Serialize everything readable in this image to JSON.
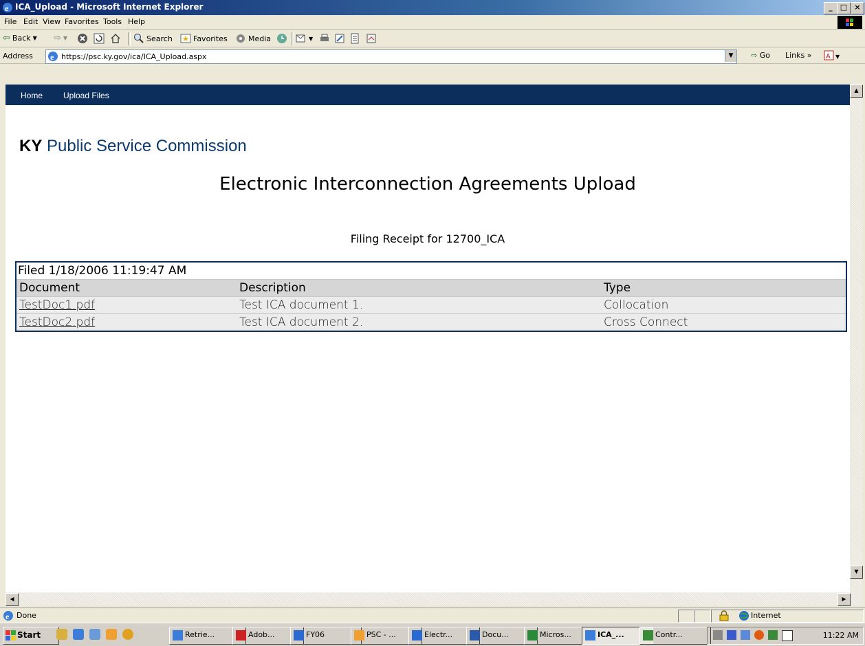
{
  "window": {
    "title": "ICA_Upload - Microsoft Internet Explorer",
    "controls": [
      "_",
      "□",
      "×"
    ]
  },
  "menubar": {
    "items": [
      "File",
      "Edit",
      "View",
      "Favorites",
      "Tools",
      "Help"
    ]
  },
  "toolbar": {
    "back": "Back",
    "search": "Search",
    "favorites": "Favorites",
    "media": "Media"
  },
  "addressbar": {
    "label": "Address",
    "url": "https://psc.ky.gov/ica/ICA_Upload.aspx",
    "go": "Go",
    "links": "Links"
  },
  "page": {
    "nav": [
      "Home",
      "Upload Files"
    ],
    "brand_prefix": "KY",
    "brand_name": "Public Service Commission",
    "heading": "Electronic Interconnection Agreements Upload",
    "receipt_title": "Filing Receipt for 12700_ICA",
    "filing": {
      "filed_label": "Filed 1/18/2006 11:19:47 AM",
      "columns": [
        "Document",
        "Description",
        "Type"
      ],
      "rows": [
        {
          "document": "TestDoc1.pdf",
          "description": "Test ICA document 1.",
          "type": "Collocation"
        },
        {
          "document": "TestDoc2.pdf",
          "description": "Test ICA document 2.",
          "type": "Cross Connect"
        }
      ]
    }
  },
  "statusbar": {
    "status": "Done",
    "zone": "Internet"
  },
  "taskbar": {
    "start": "Start",
    "tasks": [
      "Retrie...",
      "Adob...",
      "FY06",
      "PSC - ...",
      "Electr...",
      "Docu...",
      "Micros...",
      "ICA_...",
      "Contr..."
    ],
    "clock": "11:22 AM"
  },
  "colors": {
    "nav_bg": "#0b2e5c",
    "brand_blue": "#0b3a6e",
    "link": "#1a3aa0"
  }
}
